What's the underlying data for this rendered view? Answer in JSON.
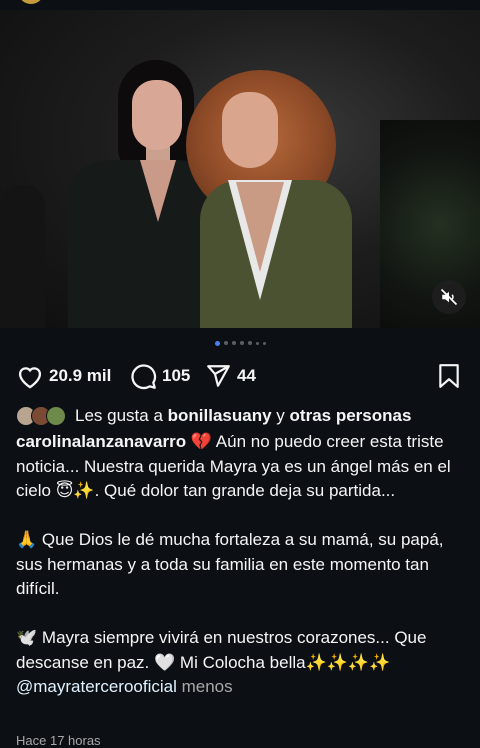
{
  "post": {
    "image_alt_emoji": "",
    "carousel": {
      "total_dots": 7,
      "active_index": 0
    },
    "mute_icon": "speaker-muted-icon"
  },
  "actions": {
    "likes": "20.9 mil",
    "comments": "105",
    "shares": "44",
    "like_icon": "heart-icon",
    "comment_icon": "comment-bubble-icon",
    "share_icon": "paper-plane-icon",
    "save_icon": "bookmark-icon"
  },
  "liked_by": {
    "prefix": "Les gusta a",
    "user": "bonillasuany",
    "joiner": "y",
    "others": "otras personas"
  },
  "caption": {
    "username": "carolinalanzanavarro",
    "para1_emoji": "💔",
    "para1": "Aún no puedo creer esta triste noticia... Nuestra querida Mayra ya es un ángel más en el cielo",
    "para1_emoji2": "😇✨",
    "para1_end": ". Qué dolor tan grande deja su partida...",
    "para2_emoji": "🙏",
    "para2": "Que Dios le dé mucha fortaleza a su mamá, su papá, sus hermanas y a toda su familia en este momento tan difícil.",
    "para3_emoji": "🕊️",
    "para3": "Mayra siempre vivirá en nuestros corazones... Que descanse en paz.",
    "para3_heart": "🤍",
    "para3_end": "Mi Colocha bella",
    "para3_sparkles": "✨✨✨✨",
    "mention": "@mayratercerooficial",
    "less": "menos"
  },
  "timestamp": "Hace 17 horas",
  "colors": {
    "background": "#0c1014",
    "text": "#f5f5f5",
    "muted": "#a8a8a8",
    "dot_active": "#4a7ff0"
  }
}
